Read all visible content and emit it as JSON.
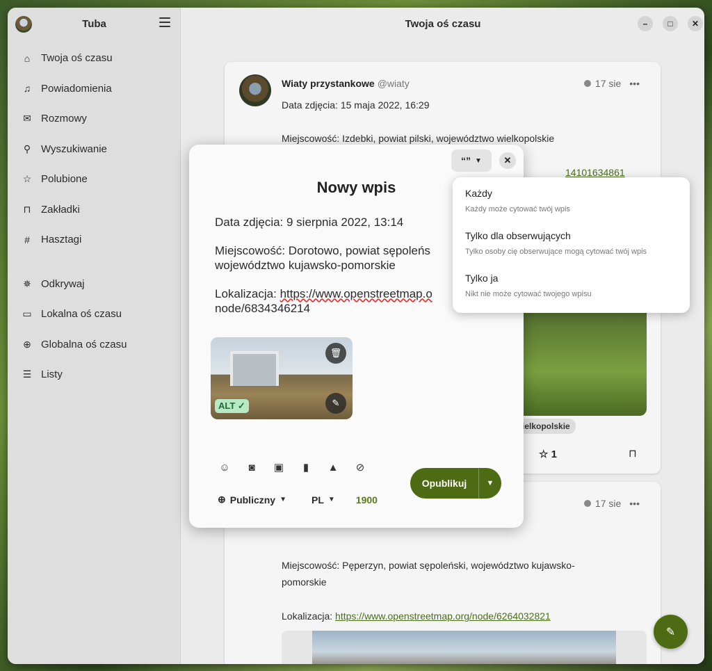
{
  "sidebar": {
    "title": "Tuba",
    "items": [
      {
        "label": "Twoja oś czasu",
        "icon": "home-icon"
      },
      {
        "label": "Powiadomienia",
        "icon": "bell-icon"
      },
      {
        "label": "Rozmowy",
        "icon": "mail-icon"
      },
      {
        "label": "Wyszukiwanie",
        "icon": "search-icon"
      },
      {
        "label": "Polubione",
        "icon": "star-icon"
      },
      {
        "label": "Zakładki",
        "icon": "bookmark-icon"
      },
      {
        "label": "Hasztagi",
        "icon": "hashtag-icon"
      },
      {
        "label": "Odkrywaj",
        "icon": "explore-icon"
      },
      {
        "label": "Lokalna oś czasu",
        "icon": "local-icon"
      },
      {
        "label": "Globalna oś czasu",
        "icon": "globe-icon"
      },
      {
        "label": "Listy",
        "icon": "list-icon"
      }
    ]
  },
  "header": {
    "title": "Twoja oś czasu"
  },
  "post1": {
    "author": "Wiaty przystankowe",
    "handle": "@wiaty",
    "time": "17 sie",
    "line1": "Data zdjęcia: 15 maja 2022, 16:29",
    "line2": "Miejscowość: Izdebki, powiat pilski, województwo wielkopolskie",
    "partial_link": "14101634861",
    "tag": "ielkopolskie",
    "fav_count": "1"
  },
  "post2": {
    "time": "17 sie",
    "line1": "Miejscowość: Pęperzyn, powiat sępoleński, województwo kujawsko-",
    "line1b": "pomorskie",
    "loc_label": "Lokalizacja:",
    "loc_link": "https://www.openstreetmap.org/node/6264032821"
  },
  "composer": {
    "title": "Nowy wpis",
    "text1": "Data zdjęcia: 9 sierpnia 2022, 13:14",
    "text2a": "Miejscowość: Dorotowo, powiat sępoleńs",
    "text2b": "województwo kujawsko-pomorskie",
    "text3a_label": "Lokalizacja: ",
    "text3a_link": "https://www.openstreetmap.o",
    "text3b": "node/6834346214",
    "alt_badge": "ALT ✓",
    "visibility": "Publiczny",
    "language": "PL",
    "char_count": "1900",
    "publish": "Opublikuj",
    "quote_icon_text": "“”"
  },
  "quote_menu": {
    "options": [
      {
        "title": "Każdy",
        "subtitle": "Każdy może cytować twój wpis"
      },
      {
        "title": "Tylko dla obserwujących",
        "subtitle": "Tylko osoby cię obserwujące mogą cytować twój wpis"
      },
      {
        "title": "Tylko ja",
        "subtitle": "Nikt nie może cytować twojego wpisu"
      }
    ]
  }
}
